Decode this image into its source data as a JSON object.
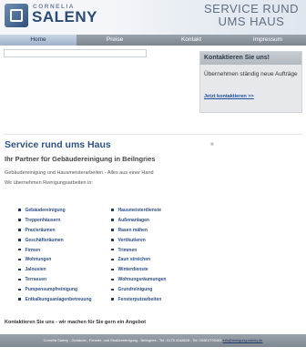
{
  "header": {
    "brand_small": "CORNELIA",
    "brand_big": "SALENY",
    "slogan_line1": "SERVICE RUND",
    "slogan_line2": "UMS HAUS"
  },
  "nav": {
    "items": [
      "Home",
      "Preise",
      "Kontakt",
      "Impressum"
    ],
    "active": "Home"
  },
  "contact_box": {
    "title": "Kontaktieren Sie uns!",
    "text": "Übernehmen ständig neue Aufträge",
    "link": "Jetzt kontaktieren >>"
  },
  "main": {
    "title": "Service rund ums Haus",
    "subtitle": "Ihr Partner für Gebäudereinigung in Beilngries",
    "intro1": "Gebäudereinigung und Hausmeisterarbeiten - Alles aus einer Hand",
    "intro2": "Wir übernehmen Reinigungsarbeiten in:",
    "list_left": [
      "Gebäudereinigung",
      "Treppenhäusern",
      "Praxisräumen",
      "Geschäftsräumen",
      "Firmen",
      "Wohnungen",
      "Jalousien",
      "Terrassen",
      "Pumpensumpfreinigung",
      "Entkalkungsanlagenbetreuung"
    ],
    "list_right": [
      "Hausmeisterdienste",
      "Außenanlagen",
      "Rasen mähen",
      "Vertikutieren",
      "Trimmen",
      "Zaun streichen",
      "Winterdienste",
      "Wohnungsräumungen",
      "Grundreinigung",
      "Fensterputzarbeiten"
    ],
    "cta": "Kontaktieren Sie uns - wir machen für Sie gern ein Angebot"
  },
  "footer": {
    "text": "Cornelia Saleny - Gebäude-, Fenster- und Straßenreinigung - Beilngries - Tel.: 0175 4148628 - Tel: 08461/700463 ",
    "email": "info@reinigung-saleny.de"
  },
  "colors": {
    "brand_blue": "#2b4b76",
    "title_blue": "#2d5286",
    "nav_gray": "#8a929b",
    "nav_active": "#b3c3d7"
  },
  "icons": [
    "logo-mark-icon",
    "bullet-icon"
  ]
}
